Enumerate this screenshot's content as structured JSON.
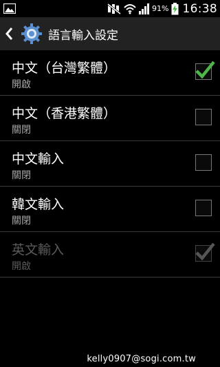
{
  "status_bar": {
    "battery_percent": "91%",
    "time": "16:38",
    "icons": [
      "image-notification-icon",
      "mute-icon",
      "wifi-icon",
      "signal-icon",
      "battery-charging-icon"
    ]
  },
  "action_bar": {
    "title": "語言輸入設定",
    "icons": [
      "back-chevron-icon",
      "settings-gear-icon"
    ]
  },
  "list": [
    {
      "label": "中文（台灣繁體）",
      "status": "開啟",
      "checked": true,
      "enabled": true
    },
    {
      "label": "中文（香港繁體）",
      "status": "關閉",
      "checked": false,
      "enabled": true
    },
    {
      "label": "中文輸入",
      "status": "關閉",
      "checked": false,
      "enabled": true
    },
    {
      "label": "韓文輸入",
      "status": "關閉",
      "checked": false,
      "enabled": true
    },
    {
      "label": "英文輸入",
      "status": "開啟",
      "checked": true,
      "enabled": false
    }
  ],
  "footer": {
    "watermark": "kelly0907@sogi.com.tw"
  },
  "colors": {
    "accent_check": "#4fb64a",
    "background": "#000000",
    "action_bar": "#222222"
  }
}
